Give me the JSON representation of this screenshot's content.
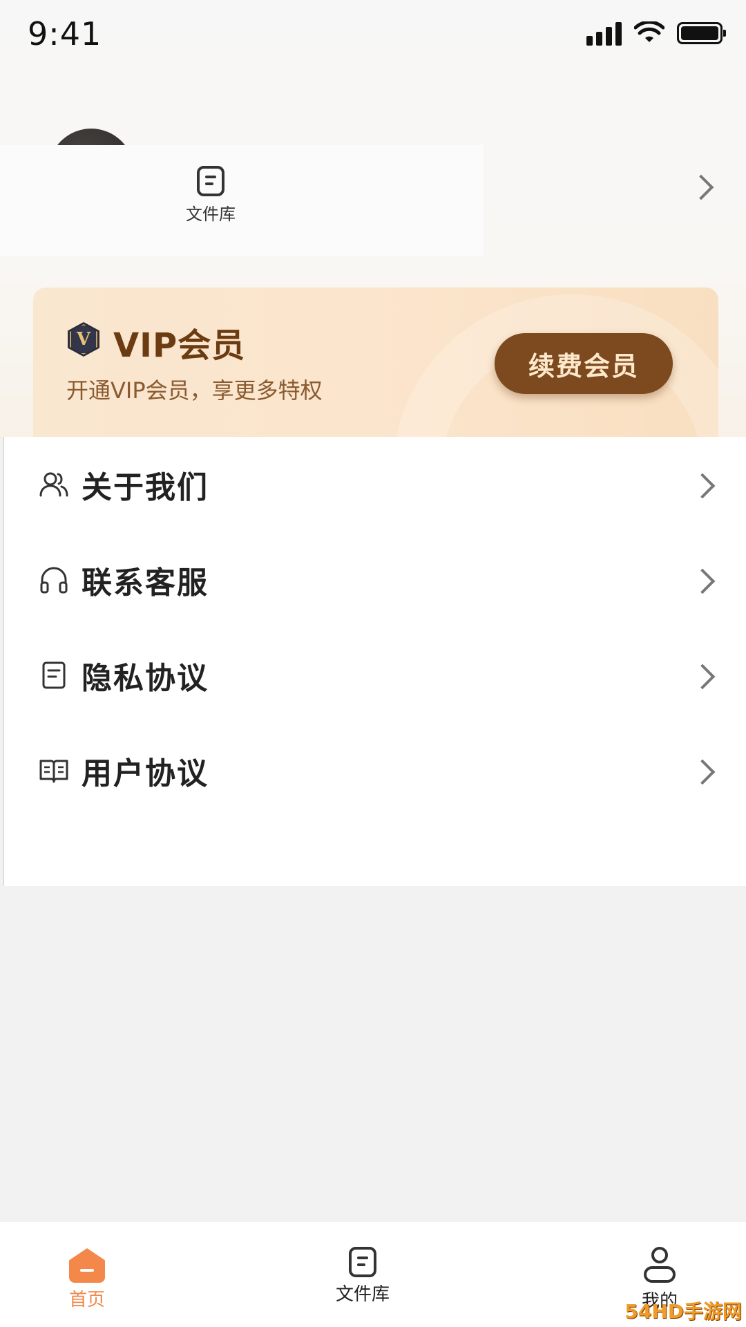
{
  "status_bar": {
    "time": "9:41"
  },
  "quick_access": {
    "label": "文件库"
  },
  "vip": {
    "badge_letter": "V",
    "title": "VIP会员",
    "subtitle": "开通VIP会员，享更多特权",
    "button_label": "续费会员",
    "colors": {
      "card": "#fbe5cc",
      "button": "#7c4a1e",
      "title": "#6b3b12"
    }
  },
  "menu": {
    "items": [
      {
        "label": "关于我们",
        "icon": "users-icon"
      },
      {
        "label": "联系客服",
        "icon": "headset-icon"
      },
      {
        "label": "隐私协议",
        "icon": "document-icon"
      },
      {
        "label": "用户协议",
        "icon": "book-icon"
      }
    ]
  },
  "bottom_nav": {
    "items": [
      {
        "label": "首页",
        "icon": "home-icon",
        "active": true
      },
      {
        "label": "文件库",
        "icon": "file-library-icon",
        "active": false
      },
      {
        "label": "我的",
        "icon": "user-icon",
        "active": false
      }
    ],
    "accent": "#f0874a"
  },
  "watermark": {
    "text": "54HD手游网"
  }
}
